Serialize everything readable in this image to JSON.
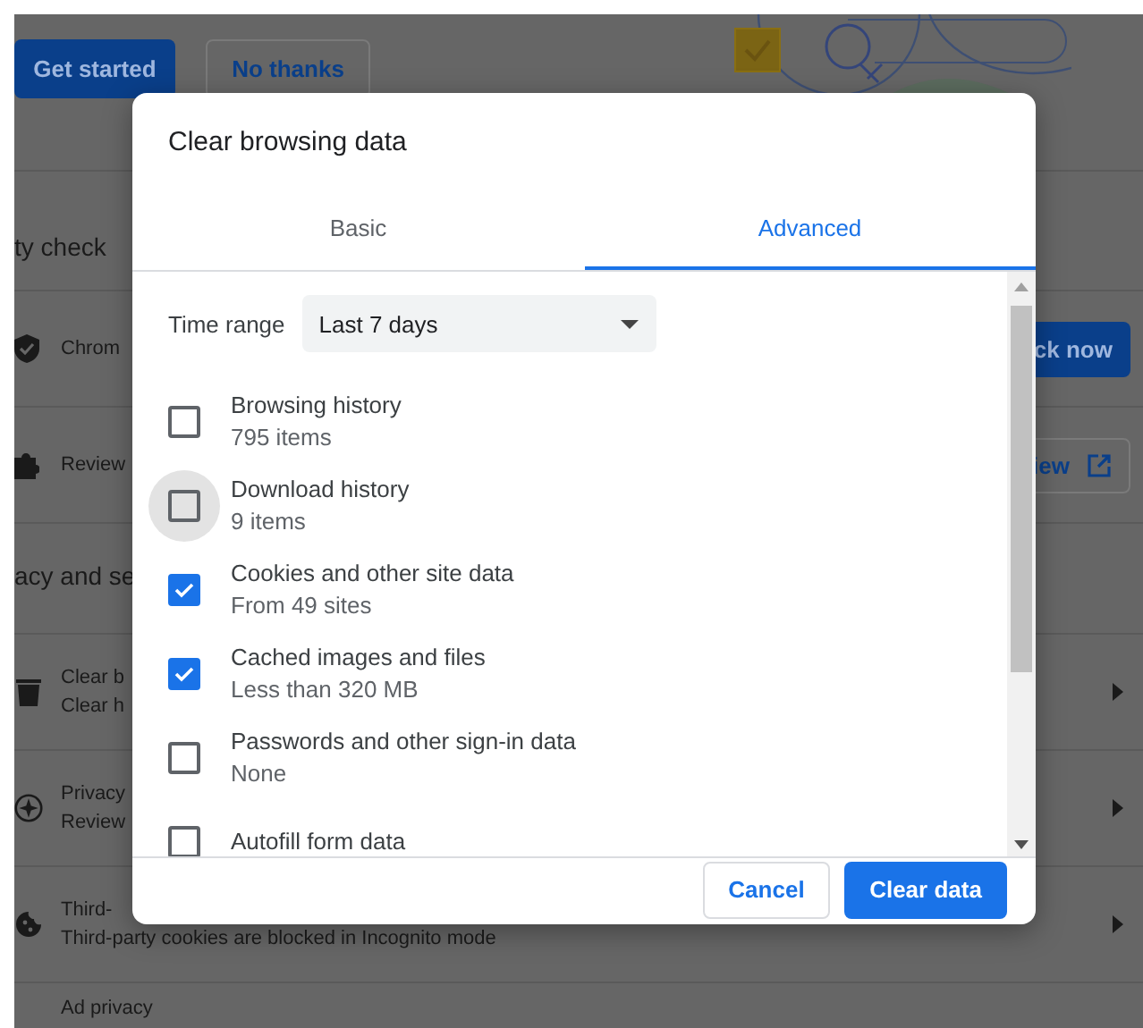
{
  "background_page": {
    "banner": {
      "buttons": [
        {
          "label": "Get started",
          "kind": "primary"
        },
        {
          "label": "No thanks",
          "kind": "secondary"
        }
      ]
    },
    "safety_check": {
      "heading": "ty check",
      "rows": [
        {
          "label": "Chrom",
          "button": "ck now",
          "kind": "primary"
        },
        {
          "label": "Review",
          "button": "iew",
          "kind": "external"
        }
      ]
    },
    "privacy": {
      "heading": "acy and se",
      "rows": [
        {
          "title": "Clear b",
          "subtitle": "Clear h"
        },
        {
          "title": "Privacy",
          "subtitle": "Review"
        },
        {
          "title": "Third-",
          "subtitle": "Third-party cookies are blocked in Incognito mode"
        },
        {
          "title": "Ad privacy"
        }
      ]
    }
  },
  "dialog": {
    "title": "Clear browsing data",
    "tabs": [
      {
        "label": "Basic",
        "selected": false
      },
      {
        "label": "Advanced",
        "selected": true
      }
    ],
    "time_range": {
      "label": "Time range",
      "value": "Last 7 days"
    },
    "items": [
      {
        "label": "Browsing history",
        "detail": "795 items",
        "checked": false,
        "hovered": false
      },
      {
        "label": "Download history",
        "detail": "9 items",
        "checked": false,
        "hovered": true
      },
      {
        "label": "Cookies and other site data",
        "detail": "From 49 sites",
        "checked": true,
        "hovered": false
      },
      {
        "label": "Cached images and files",
        "detail": "Less than 320 MB",
        "checked": true,
        "hovered": false
      },
      {
        "label": "Passwords and other sign-in data",
        "detail": "None",
        "checked": false,
        "hovered": false
      },
      {
        "label": "Autofill form data",
        "checked": false,
        "hovered": false
      }
    ],
    "buttons": [
      {
        "label": "Cancel",
        "kind": "secondary"
      },
      {
        "label": "Clear data",
        "kind": "primary"
      }
    ]
  }
}
